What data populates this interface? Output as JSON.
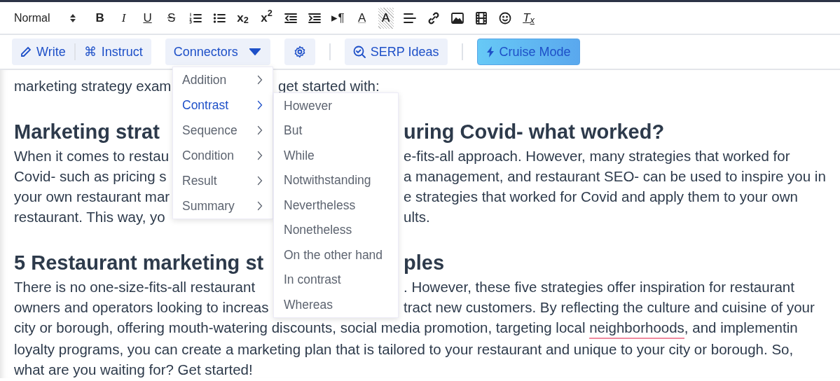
{
  "format_toolbar": {
    "style_select": {
      "value": "Normal"
    },
    "labels": [
      "B",
      "I",
      "U",
      "S",
      "x$_{2}$",
      "x$^{2}$",
      "▸¶",
      "A",
      "A",
      "T$_{x}$"
    ]
  },
  "ai_toolbar": {
    "write": {
      "label": "Write"
    },
    "instruct": {
      "glyph": "⌘",
      "label": "Instruct"
    },
    "connectors": {
      "label": "Connectors",
      "expanded": true
    },
    "serp": {
      "label": "SERP Ideas"
    },
    "cruise": {
      "label": "Cruise Mode"
    }
  },
  "connectors_menu": {
    "items": [
      {
        "label": "Addition",
        "selected": false
      },
      {
        "label": "Contrast",
        "selected": true
      },
      {
        "label": "Sequence",
        "selected": false
      },
      {
        "label": "Condition",
        "selected": false
      },
      {
        "label": "Result",
        "selected": false
      },
      {
        "label": "Summary",
        "selected": false
      }
    ]
  },
  "submenu": {
    "items": [
      "However",
      "But",
      "While",
      "Notwithstanding",
      "Nevertheless",
      "Nonetheless",
      "On the other hand",
      "In contrast",
      "Whereas"
    ]
  },
  "document": {
    "blocks": [
      {
        "kind": "paragraph",
        "lines": [
          {
            "left": "marketing strategy exam",
            "right": "get started with:"
          }
        ]
      },
      {
        "kind": "heading",
        "lines": [
          {
            "left": "Marketing strat",
            "right": "uring Covid- what worked?"
          }
        ]
      },
      {
        "kind": "paragraph",
        "lines": [
          {
            "left": "When it comes to restau",
            "right": "e-fits-all approach. However, many strategies that worked for"
          },
          {
            "left": "Covid- such as pricing s",
            "right": "a management, and restaurant SEO- can be used to inspire you in"
          },
          {
            "left": "your own restaurant mar",
            "right": "e strategies that worked for Covid and apply them to your own"
          },
          {
            "left": "restaurant. This way, yo",
            "right": "ults."
          }
        ]
      },
      {
        "kind": "heading",
        "lines": [
          {
            "left": "5 Restaurant marketing st",
            "right": "ples"
          }
        ]
      },
      {
        "kind": "paragraph",
        "lines": [
          {
            "left": "There is no one-size-fits-all restaurant",
            "right": ". However, these five strategies offer inspiration for restaurant"
          },
          {
            "left": "owners and operators looking to increas",
            "right": "tract new customers. By reflecting the culture and cuisine of your"
          },
          {
            "text": "city or borough, offering mouth-watering discounts, social media promotion, targeting local ",
            "flagged": "neighborhoods",
            "after": ", and implementin"
          },
          {
            "text": "loyalty programs, you can create a marketing plan that is tailored to your restaurant and unique to your city or borough. So,"
          },
          {
            "text": "what are you waiting for? Get started!"
          }
        ]
      }
    ]
  }
}
